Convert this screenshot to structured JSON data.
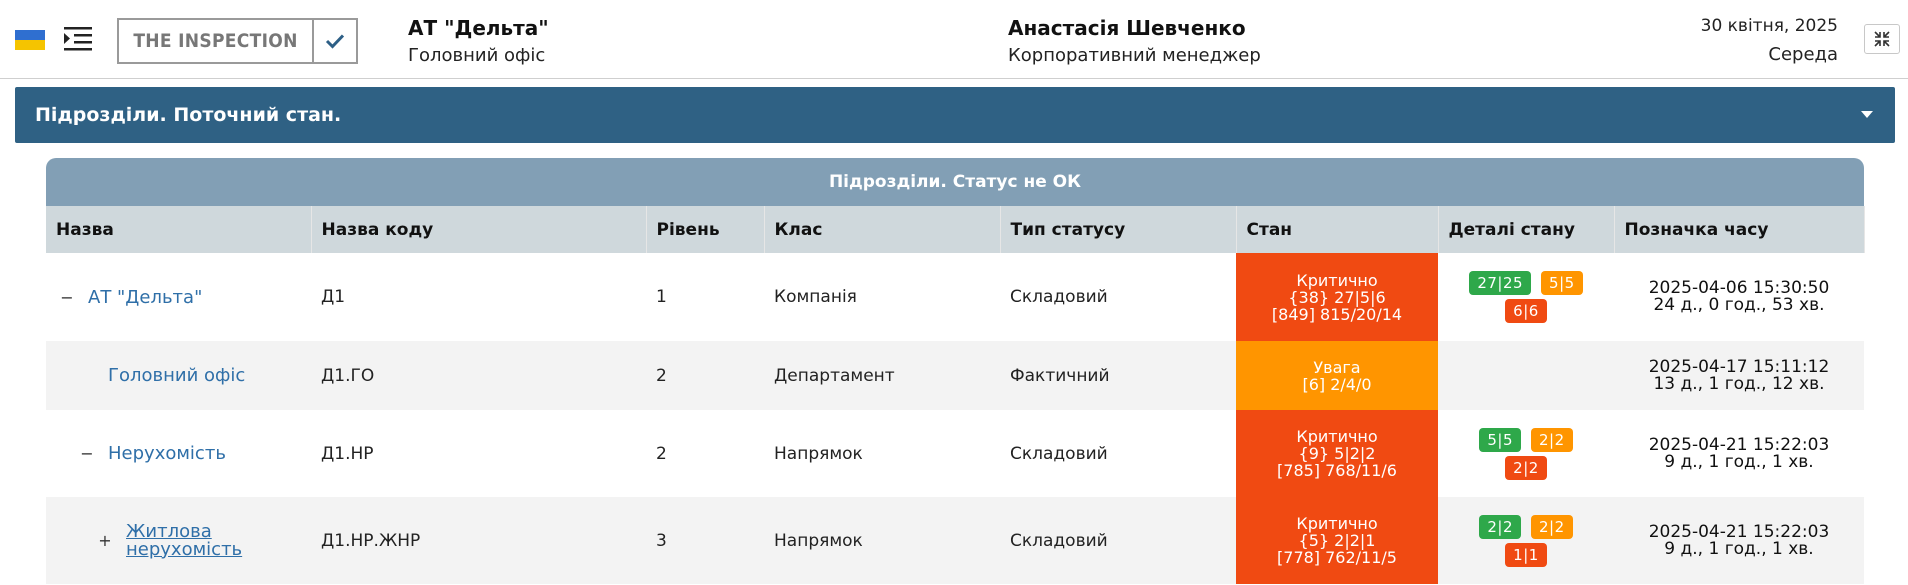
{
  "header": {
    "brand": "THE INSPECTION",
    "org_name": "АТ \"Дельта\"",
    "org_sub": "Головний офіс",
    "user_name": "Анастасія Шевченко",
    "user_role": "Корпоративний менеджер",
    "date": "30 квітня, 2025",
    "weekday": "Середа",
    "flag_colors": [
      "#2f6fd0",
      "#f5c400"
    ]
  },
  "panel": {
    "title": "Підрозділи. Поточний стан."
  },
  "table": {
    "caption": "Підрозділи. Статус не ОК",
    "columns": [
      "Назва",
      "Назва коду",
      "Рівень",
      "Клас",
      "Тип статусу",
      "Стан",
      "Деталі стану",
      "Позначка часу"
    ],
    "rows": [
      {
        "toggle": "−",
        "name": "АТ \"Дельта\"",
        "code": "Д1",
        "level": "1",
        "class": "Компанія",
        "status_type": "Складовий",
        "state": "critical",
        "state_lines": [
          "Критично",
          "{38} 27|5|6",
          "[849] 815/20/14"
        ],
        "badges": [
          {
            "text": "27|25",
            "color": "green"
          },
          {
            "text": "5|5",
            "color": "orange"
          },
          {
            "text": "6|6",
            "color": "red"
          }
        ],
        "ts_date": "2025-04-06 15:30:50",
        "ts_ago": "24 д., 0 год., 53 хв."
      },
      {
        "toggle": "",
        "name": "Головний офіс",
        "code": "Д1.ГО",
        "level": "2",
        "class": "Департамент",
        "status_type": "Фактичний",
        "state": "warning",
        "state_lines": [
          "Увага",
          "[6] 2/4/0"
        ],
        "badges": [],
        "ts_date": "2025-04-17 15:11:12",
        "ts_ago": "13 д., 1 год., 12 хв."
      },
      {
        "toggle": "−",
        "name": "Нерухомість",
        "code": "Д1.НР",
        "level": "2",
        "class": "Напрямок",
        "status_type": "Складовий",
        "state": "critical",
        "state_lines": [
          "Критично",
          "{9} 5|2|2",
          "[785] 768/11/6"
        ],
        "badges": [
          {
            "text": "5|5",
            "color": "green"
          },
          {
            "text": "2|2",
            "color": "orange"
          },
          {
            "text": "2|2",
            "color": "red"
          }
        ],
        "ts_date": "2025-04-21 15:22:03",
        "ts_ago": "9 д., 1 год., 1 хв."
      },
      {
        "toggle": "+",
        "name": "Житлова нерухомість",
        "code": "Д1.НР.ЖНР",
        "level": "3",
        "class": "Напрямок",
        "status_type": "Складовий",
        "state": "critical",
        "state_lines": [
          "Критично",
          "{5} 2|2|1",
          "[778] 762/11/5"
        ],
        "badges": [
          {
            "text": "2|2",
            "color": "green"
          },
          {
            "text": "2|2",
            "color": "orange"
          },
          {
            "text": "1|1",
            "color": "red"
          }
        ],
        "ts_date": "2025-04-21 15:22:03",
        "ts_ago": "9 д., 1 год., 1 хв."
      }
    ]
  }
}
